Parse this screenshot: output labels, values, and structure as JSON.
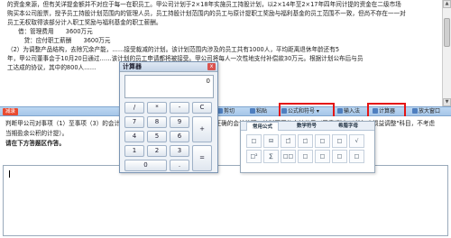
{
  "question": {
    "lines": [
      "的资金来源，但有关详提金额并不对应于每一在职员工。甲公司计划于2×18年实施员工持股计划，以2×14年至2×17年四年间计提的资金在二级市场",
      "购买本公司股票，授予员工持股计划范围内的管理人员，员工持股计划范围内的员工与原计提职工奖励与福利基金的员工范围不一致，但尚不存在一一对",
      "员工无权取得该部分计入职工奖励与福利基金的职工薪酬。",
      "借：管理费用　　3600万元",
      "　贷：应付职工薪酬　　3600万元",
      "（2）为调整产品结构，去除冗余产能，……接受裁减的计划。该计划范围内涉及的员工共有1000人，平均距离退休年龄还有5",
      "年，甲公司董事会于10月20日通过……该计划的员工申请都将被接受。甲公司将每人一次性地支付补偿款30万元。根据计划公布后与员",
      "工达成的协议，其中的800人……"
    ]
  },
  "toolbar": {
    "title": "减录",
    "buttons": [
      "剪切",
      "粘贴",
      "公式和符号",
      "输入法",
      "计算器",
      "放大窗口"
    ],
    "fx_label": "公式和符号 ▾",
    "input_label": "输入法",
    "calc_label": "计算器",
    "zoom_label": "放大窗口",
    "cut_label": "剪切",
    "paste_label": "粘贴"
  },
  "answer": {
    "line1": "判断甲公司对事项（1）至事项（3）的会计处理是否正确，并说明理由；对于不正确的会计处理，编制更正的会计分录（无需通过\"以前年度损益调整\"科目，不考虑",
    "line2": "当期盈余公积的计提）。",
    "prompt": "请在下方答题区作答。"
  },
  "calculator": {
    "title": "计算器",
    "close": "x",
    "display": "0",
    "keys": [
      "/",
      "*",
      "-",
      "C",
      "7",
      "8",
      "9",
      "+",
      "4",
      "5",
      "6",
      "1",
      "2",
      "3",
      "=",
      "0",
      "."
    ]
  },
  "formula_panel": {
    "tabs": [
      "常用公式",
      "数学符号",
      "希腊字母"
    ],
    "cells": [
      "□",
      "⊟",
      "□̄",
      "□̇",
      "□",
      "□",
      "√",
      "□²",
      "∑",
      "□□",
      "□",
      "□",
      "□",
      "□"
    ]
  }
}
